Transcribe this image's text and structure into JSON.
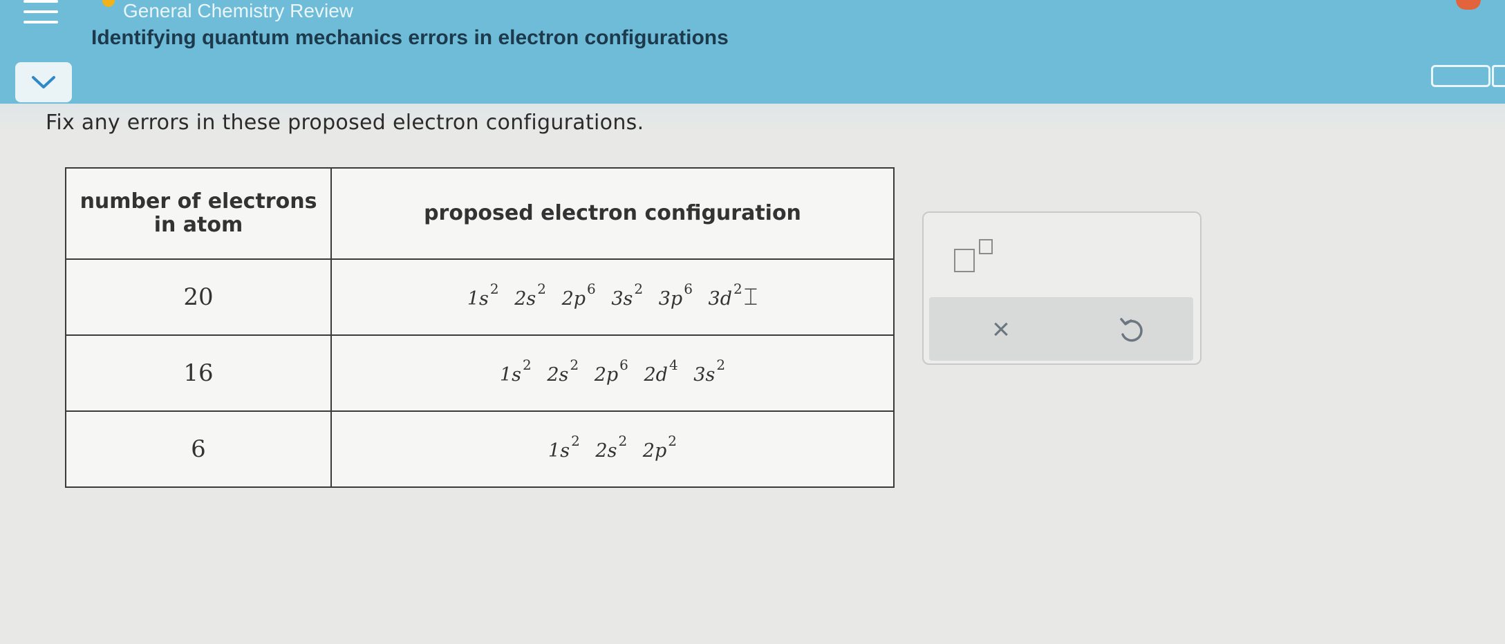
{
  "header": {
    "course_title": "General Chemistry Review",
    "topic_title": "Identifying quantum mechanics errors in electron configurations"
  },
  "question": {
    "instructions": "Fix any errors in these proposed electron configurations."
  },
  "table": {
    "col_num_header": "number of electrons in atom",
    "col_config_header": "proposed electron configuration",
    "rows": [
      {
        "electrons": "20",
        "terms": [
          {
            "orbital": "1s",
            "exp": "2"
          },
          {
            "orbital": "2s",
            "exp": "2"
          },
          {
            "orbital": "2p",
            "exp": "6"
          },
          {
            "orbital": "3s",
            "exp": "2"
          },
          {
            "orbital": "3p",
            "exp": "6"
          },
          {
            "orbital": "3d",
            "exp": "2"
          }
        ]
      },
      {
        "electrons": "16",
        "terms": [
          {
            "orbital": "1s",
            "exp": "2"
          },
          {
            "orbital": "2s",
            "exp": "2"
          },
          {
            "orbital": "2p",
            "exp": "6"
          },
          {
            "orbital": "2d",
            "exp": "4"
          },
          {
            "orbital": "3s",
            "exp": "2"
          }
        ]
      },
      {
        "electrons": "6",
        "terms": [
          {
            "orbital": "1s",
            "exp": "2"
          },
          {
            "orbital": "2s",
            "exp": "2"
          },
          {
            "orbital": "2p",
            "exp": "2"
          }
        ]
      }
    ]
  },
  "tools": {
    "clear_symbol": "×"
  },
  "icons": [
    "menu-icon",
    "chevron-down-icon",
    "superscript-icon",
    "close-icon",
    "undo-icon"
  ],
  "colors": {
    "header_bg": "#6fbcd9",
    "topic_text": "#1d3a4c",
    "status_dot": "#f2b21c"
  }
}
